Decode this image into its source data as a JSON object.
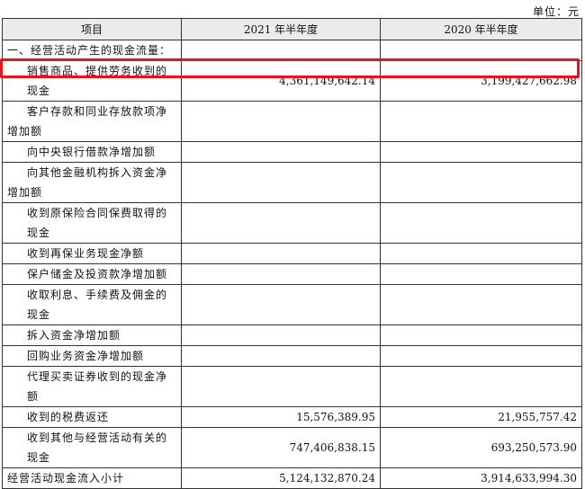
{
  "unit_label": "单位：元",
  "headers": {
    "item": "项目",
    "col_2021": "2021 年半年度",
    "col_2020": "2020 年半年度"
  },
  "rows": [
    {
      "label": "一、经营活动产生的现金流量：",
      "v2021": "",
      "v2020": ""
    },
    {
      "label": "销售商品、提供劳务收到的现金",
      "v2021": "4,361,149,642.14",
      "v2020": "3,199,427,662.98"
    },
    {
      "label": "客户存款和同业存放款项净增加额",
      "v2021": "",
      "v2020": ""
    },
    {
      "label": "向中央银行借款净增加额",
      "v2021": "",
      "v2020": ""
    },
    {
      "label": "向其他金融机构拆入资金净增加额",
      "v2021": "",
      "v2020": ""
    },
    {
      "label": "收到原保险合同保费取得的现金",
      "v2021": "",
      "v2020": ""
    },
    {
      "label": "收到再保业务现金净额",
      "v2021": "",
      "v2020": ""
    },
    {
      "label": "保户储金及投资款净增加额",
      "v2021": "",
      "v2020": ""
    },
    {
      "label": "收取利息、手续费及佣金的现金",
      "v2021": "",
      "v2020": ""
    },
    {
      "label": "拆入资金净增加额",
      "v2021": "",
      "v2020": ""
    },
    {
      "label": "回购业务资金净增加额",
      "v2021": "",
      "v2020": ""
    },
    {
      "label": "代理买卖证券收到的现金净额",
      "v2021": "",
      "v2020": ""
    },
    {
      "label": "收到的税费返还",
      "v2021": "15,576,389.95",
      "v2020": "21,955,757.42"
    },
    {
      "label": "收到其他与经营活动有关的现金",
      "v2021": "747,406,838.15",
      "v2020": "693,250,573.90"
    },
    {
      "label": "经营活动现金流入小计",
      "v2021": "5,124,132,870.24",
      "v2020": "3,914,633,994.30"
    }
  ],
  "highlight_color": "#e8121c"
}
